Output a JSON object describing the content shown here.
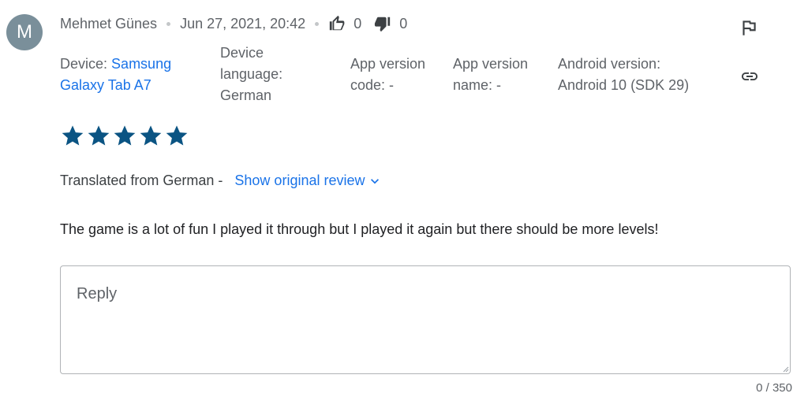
{
  "review": {
    "avatar_letter": "M",
    "author": "Mehmet Günes",
    "date": "Jun 27, 2021, 20:42",
    "thumbs_up_count": "0",
    "thumbs_down_count": "0",
    "rating": 5,
    "rating_max": 5,
    "translated_label": "Translated from German -",
    "show_original_label": "Show original review",
    "text": "The game is a lot of fun I played it through but I played it again but there should be more levels!"
  },
  "device_info": {
    "device_label": "Device:",
    "device_value_line1": "Samsung",
    "device_value_line2": "Galaxy Tab A7",
    "language_line1": "Device",
    "language_line2": "language:",
    "language_value": "German",
    "app_version_code_line1": "App version",
    "app_version_code_line2": "code: -",
    "app_version_name_line1": "App version",
    "app_version_name_line2": "name: -",
    "android_version_line1": "Android version:",
    "android_version_line2": "Android 10 (SDK 29)"
  },
  "reply": {
    "placeholder": "Reply",
    "value": "",
    "counter": "0 / 350"
  },
  "icons": {
    "flag": "flag-icon",
    "link": "link-icon",
    "thumbs_up": "thumbs-up-icon",
    "thumbs_down": "thumbs-down-icon",
    "chevron": "chevron-down-icon",
    "star": "star-icon"
  },
  "colors": {
    "star": "#0b5483",
    "link": "#1a73e8",
    "avatar": "#7a8f9a"
  }
}
